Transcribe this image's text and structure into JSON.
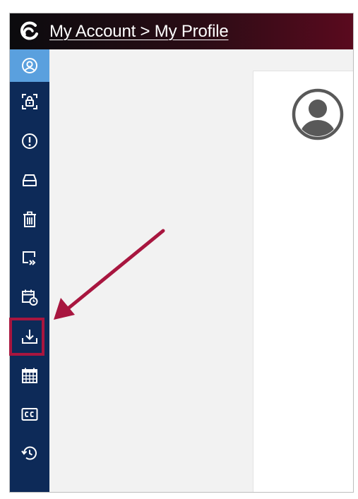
{
  "header": {
    "breadcrumb": "My Account > My Profile",
    "logo_icon": "swirl-logo-icon"
  },
  "sidebar": {
    "items": [
      {
        "name": "profile",
        "icon": "user-circle-icon",
        "active": true
      },
      {
        "name": "security",
        "icon": "lock-icon",
        "active": false
      },
      {
        "name": "alerts",
        "icon": "exclamation-circle-icon",
        "active": false
      },
      {
        "name": "storage",
        "icon": "hard-drive-icon",
        "active": false
      },
      {
        "name": "trash",
        "icon": "trash-icon",
        "active": false
      },
      {
        "name": "forwarding",
        "icon": "share-forward-icon",
        "active": false
      },
      {
        "name": "schedule",
        "icon": "calendar-clock-icon",
        "active": false
      },
      {
        "name": "downloads",
        "icon": "download-icon",
        "active": false,
        "highlighted": true
      },
      {
        "name": "calendar",
        "icon": "calendar-grid-icon",
        "active": false
      },
      {
        "name": "captions",
        "icon": "closed-captions-icon",
        "active": false
      },
      {
        "name": "history",
        "icon": "history-icon",
        "active": false
      }
    ]
  },
  "profile": {
    "avatar_icon": "default-avatar-icon"
  },
  "colors": {
    "header_dark": "#0b0b0e",
    "header_maroon": "#5a0a1e",
    "sidebar_bg": "#0d2a58",
    "sidebar_active": "#5aa0de",
    "annotation": "#a8163f"
  }
}
